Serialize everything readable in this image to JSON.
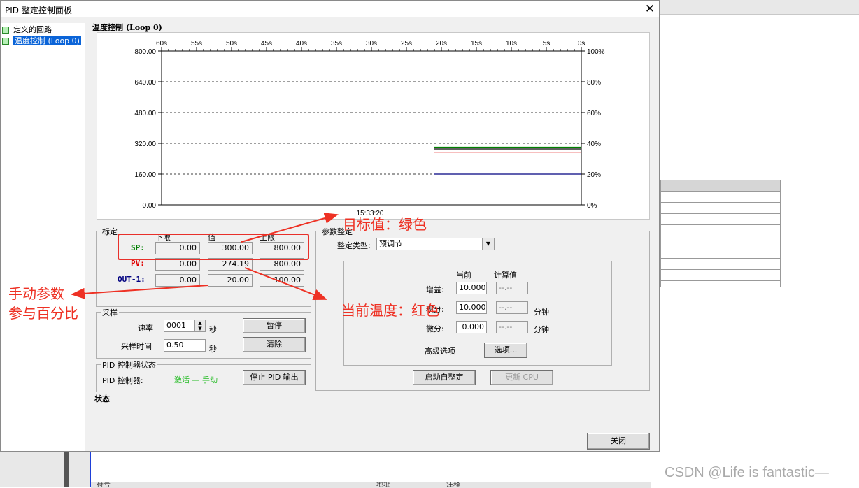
{
  "dialog": {
    "title": "PID 整定控制面板",
    "close_glyph": "✕",
    "close_label": "关闭"
  },
  "tree": {
    "items": [
      {
        "label": "定义的回路",
        "selected": false
      },
      {
        "label": "温度控制 (Loop 0)",
        "selected": true
      }
    ]
  },
  "chart_data": {
    "type": "line",
    "title": "温度控制 (Loop 0)",
    "x_ticks": [
      "60s",
      "55s",
      "50s",
      "45s",
      "40s",
      "35s",
      "30s",
      "25s",
      "20s",
      "15s",
      "10s",
      "5s",
      "0s"
    ],
    "y_left_ticks": [
      "800.00",
      "640.00",
      "480.00",
      "320.00",
      "160.00",
      "0.00"
    ],
    "y_right_ticks": [
      "100%",
      "80%",
      "60%",
      "40%",
      "20%",
      "0%"
    ],
    "ylim": [
      0,
      800
    ],
    "timestamp": "15:33:20",
    "grid": true,
    "series": [
      {
        "color": "#008000",
        "x": [
          -21,
          0
        ],
        "y": [
          300,
          300
        ]
      },
      {
        "color": "#000000",
        "x": [
          -21,
          0
        ],
        "y": [
          291,
          291
        ]
      },
      {
        "color": "#e00000",
        "x": [
          -21,
          0
        ],
        "y": [
          274.19,
          274.19
        ]
      },
      {
        "color": "#000080",
        "x": [
          -21,
          0
        ],
        "y": [
          160,
          160
        ]
      }
    ]
  },
  "calib": {
    "title": "标定",
    "col_lower": "下限",
    "col_value": "值",
    "col_upper": "上限",
    "rows": [
      {
        "name": "SP:",
        "color": "#008000",
        "lower": "0.00",
        "value": "300.00",
        "upper": "800.00"
      },
      {
        "name": "PV:",
        "color": "#e00000",
        "lower": "0.00",
        "value": "274.19",
        "upper": "800.00"
      },
      {
        "name": "OUT-1:",
        "color": "#000080",
        "lower": "0.00",
        "value": "20.00",
        "upper": "100.00"
      }
    ]
  },
  "sampling": {
    "title": "采样",
    "rate_label": "速率",
    "rate_value": "0001",
    "rate_unit": "秒",
    "time_label": "采样时间",
    "time_value": "0.50",
    "time_unit": "秒",
    "pause_button": "暂停",
    "clear_button": "清除"
  },
  "pid_status": {
    "title": "PID 控制器状态",
    "label": "PID 控制器:",
    "value": "激活 — 手动",
    "value_color": "#22bb22",
    "stop_button": "停止 PID 输出"
  },
  "status": {
    "label": "状态"
  },
  "tuning": {
    "title": "参数整定",
    "type_label": "整定类型:",
    "type_value": "预调节",
    "col_current": "当前",
    "col_calc": "计算值",
    "gain_label": "增益:",
    "gain_value": "10.000",
    "gain_calc": "--.--",
    "integral_label": "积分:",
    "integral_value": "10.000",
    "integral_calc": "--.--",
    "integral_unit": "分钟",
    "derivative_label": "微分:",
    "derivative_value": "0.000",
    "derivative_calc": "--.--",
    "derivative_unit": "分钟",
    "advanced_label": "高级选项",
    "options_button": "选项...",
    "autotune_button": "启动自整定",
    "update_cpu_button": "更新 CPU"
  },
  "annotations": {
    "target": "目标值：绿色",
    "current_temp": "当前温度：红色",
    "manual_line1": "手动参数",
    "manual_line2": "参与百分比",
    "color": "#ee3124"
  },
  "background": {
    "bottom_labels": [
      "符号",
      "地址",
      "注释"
    ]
  },
  "watermark": "CSDN @Life is fantastic—"
}
